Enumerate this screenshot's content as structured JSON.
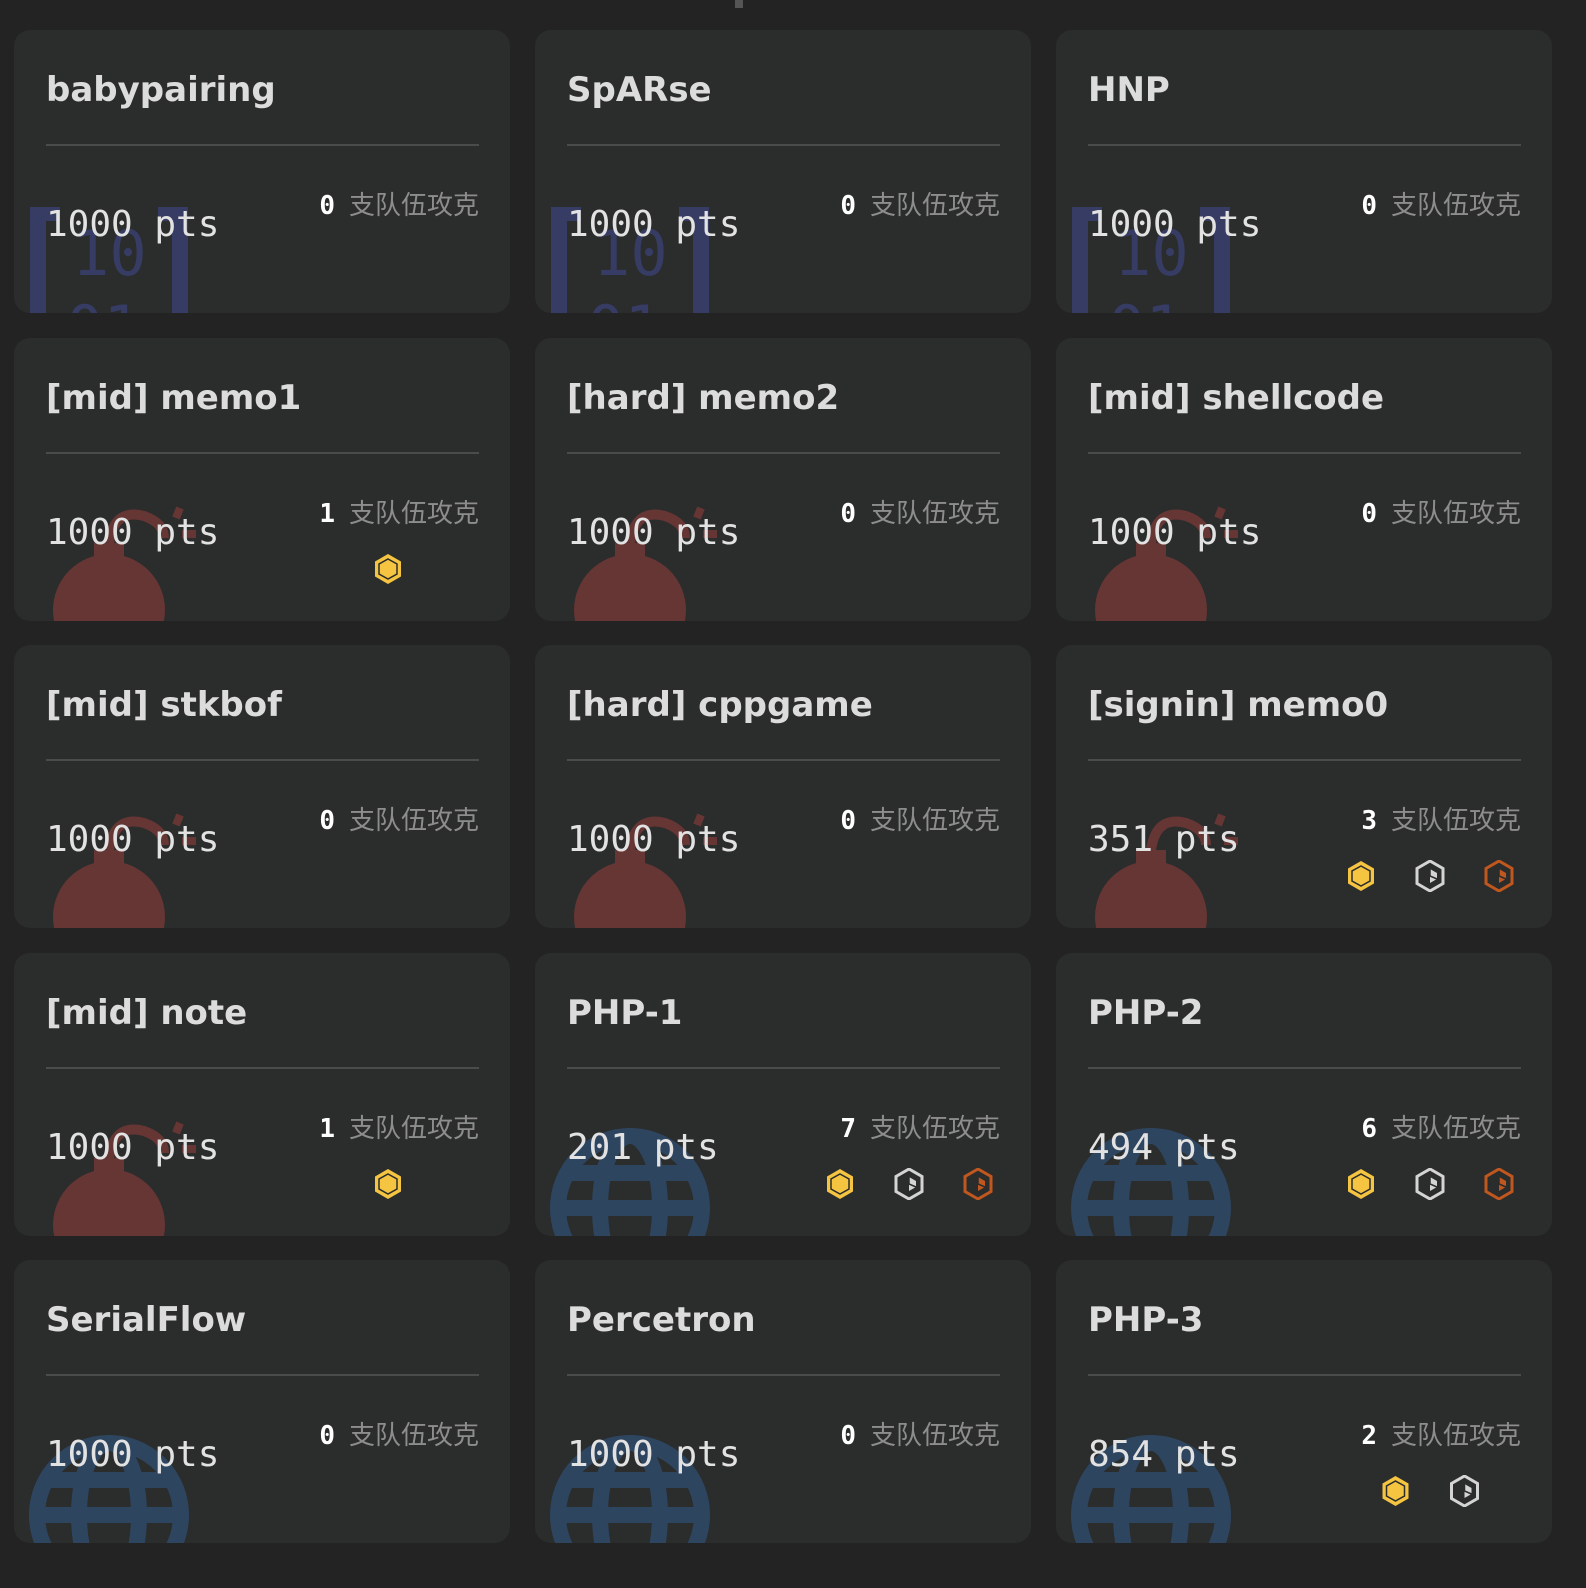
{
  "solves_label": "支队伍攻克",
  "colors": {
    "gold": "#f5c542",
    "silver": "#d4d4d4",
    "bronze": "#c0571e",
    "crypto": "#363c63",
    "pwn": "#653634",
    "web": "#2e4560"
  },
  "cards": [
    {
      "title": "babypairing",
      "pts": "1000 pts",
      "solves": "0",
      "category_icon": "crypto-icon",
      "badges": []
    },
    {
      "title": "SpARse",
      "pts": "1000 pts",
      "solves": "0",
      "category_icon": "crypto-icon",
      "badges": []
    },
    {
      "title": "HNP",
      "pts": "1000 pts",
      "solves": "0",
      "category_icon": "crypto-icon",
      "badges": []
    },
    {
      "title": "[mid] memo1",
      "pts": "1000 pts",
      "solves": "1",
      "category_icon": "bomb-icon",
      "badges": [
        "gold"
      ]
    },
    {
      "title": "[hard] memo2",
      "pts": "1000 pts",
      "solves": "0",
      "category_icon": "bomb-icon",
      "badges": []
    },
    {
      "title": "[mid] shellcode",
      "pts": "1000 pts",
      "solves": "0",
      "category_icon": "bomb-icon",
      "badges": []
    },
    {
      "title": "[mid] stkbof",
      "pts": "1000 pts",
      "solves": "0",
      "category_icon": "bomb-icon",
      "badges": []
    },
    {
      "title": "[hard] cppgame",
      "pts": "1000 pts",
      "solves": "0",
      "category_icon": "bomb-icon",
      "badges": []
    },
    {
      "title": "[signin] memo0",
      "pts": "351 pts",
      "solves": "3",
      "category_icon": "bomb-icon",
      "badges": [
        "gold",
        "silver",
        "bronze"
      ]
    },
    {
      "title": "[mid] note",
      "pts": "1000 pts",
      "solves": "1",
      "category_icon": "bomb-icon",
      "badges": [
        "gold"
      ]
    },
    {
      "title": "PHP-1",
      "pts": "201 pts",
      "solves": "7",
      "category_icon": "globe-icon",
      "badges": [
        "gold",
        "silver",
        "bronze"
      ]
    },
    {
      "title": "PHP-2",
      "pts": "494 pts",
      "solves": "6",
      "category_icon": "globe-icon",
      "badges": [
        "gold",
        "silver",
        "bronze"
      ]
    },
    {
      "title": "SerialFlow",
      "pts": "1000 pts",
      "solves": "0",
      "category_icon": "globe-icon",
      "badges": []
    },
    {
      "title": "Percetron",
      "pts": "1000 pts",
      "solves": "0",
      "category_icon": "globe-icon",
      "badges": []
    },
    {
      "title": "PHP-3",
      "pts": "854 pts",
      "solves": "2",
      "category_icon": "globe-icon",
      "badges": [
        "gold",
        "silver"
      ]
    }
  ]
}
